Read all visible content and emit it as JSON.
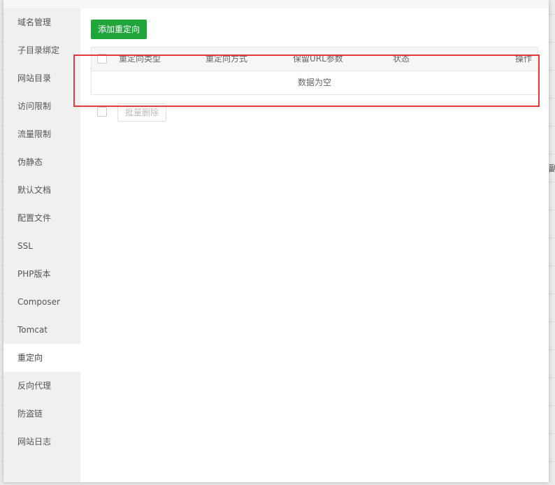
{
  "sidebar": {
    "items": [
      {
        "label": "域名管理"
      },
      {
        "label": "子目录绑定"
      },
      {
        "label": "网站目录"
      },
      {
        "label": "访问限制"
      },
      {
        "label": "流量限制"
      },
      {
        "label": "伪静态"
      },
      {
        "label": "默认文档"
      },
      {
        "label": "配置文件"
      },
      {
        "label": "SSL"
      },
      {
        "label": "PHP版本"
      },
      {
        "label": "Composer"
      },
      {
        "label": "Tomcat"
      },
      {
        "label": "重定向"
      },
      {
        "label": "反向代理"
      },
      {
        "label": "防盗链"
      },
      {
        "label": "网站日志"
      }
    ],
    "active_index": 12
  },
  "toolbar": {
    "add_label": "添加重定向"
  },
  "table": {
    "columns": [
      "重定向类型",
      "重定向方式",
      "保留URL参数",
      "状态",
      "操作"
    ],
    "empty_text": "数据为空"
  },
  "batch": {
    "delete_label": "批量删除"
  },
  "background": {
    "edge_text": "副"
  },
  "colors": {
    "accent": "#20a53a",
    "highlight": "#e8383d"
  }
}
